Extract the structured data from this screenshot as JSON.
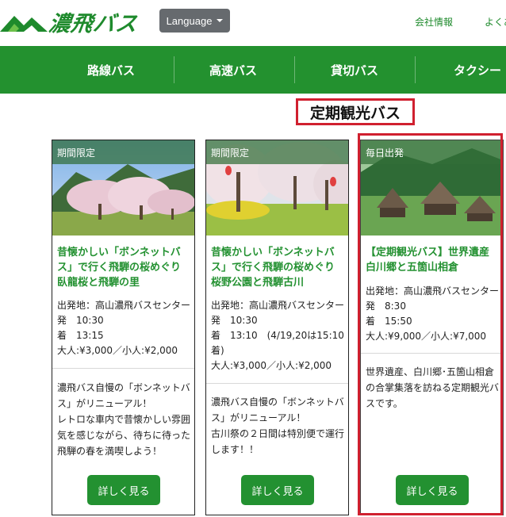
{
  "header": {
    "logo_text": "濃飛バス",
    "language_button": "Language",
    "top_links": [
      "会社情報",
      "よくあ"
    ]
  },
  "nav": {
    "items": [
      "路線バス",
      "高速バス",
      "貸切バス",
      "タクシー"
    ]
  },
  "page": {
    "title": "定期観光バス"
  },
  "cards": [
    {
      "badge": "期間限定",
      "title": "昔懐かしい「ボンネットバス」で行く飛騨の桜めぐり　臥龍桜と飛騨の里",
      "info": [
        "出発地：高山濃飛バスセンター",
        "発　10:30",
        "着　13:15",
        "大人:¥3,000／小人:¥2,000"
      ],
      "desc": "濃飛バス自慢の「ボンネットバス」がリニューアル！\nレトロな車内で昔懐かしい雰囲気を感じながら、待ちに待った飛騨の春を満喫しよう！",
      "button": "詳しく見る"
    },
    {
      "badge": "期間限定",
      "title": "昔懐かしい「ボンネットバス」で行く飛騨の桜めぐり　桜野公園と飛騨古川",
      "info": [
        "出発地：高山濃飛バスセンター",
        "発　10:30",
        "着　13:10　(4/19,20は15:10着)",
        "大人:¥3,000／小人:¥2,000"
      ],
      "desc": "濃飛バス自慢の「ボンネットバス」がリニューアル！\n古川祭の２日間は特別便で運行します！！",
      "button": "詳しく見る"
    },
    {
      "badge": "毎日出発",
      "title": "【定期観光バス】世界遺産白川郷と五箇山相倉",
      "info": [
        "出発地：高山濃飛バスセンター",
        "発　8:30",
        "着　15:50",
        "大人:¥9,000／小人:¥7,000"
      ],
      "desc": "世界遺産、白川郷･五箇山相倉の合掌集落を訪ねる定期観光バスです。",
      "button": "詳しく見る"
    }
  ],
  "colors": {
    "brand_green": "#23912f",
    "title_green": "#239131",
    "highlight_red": "#d0202f",
    "language_gray": "#666a6e"
  }
}
